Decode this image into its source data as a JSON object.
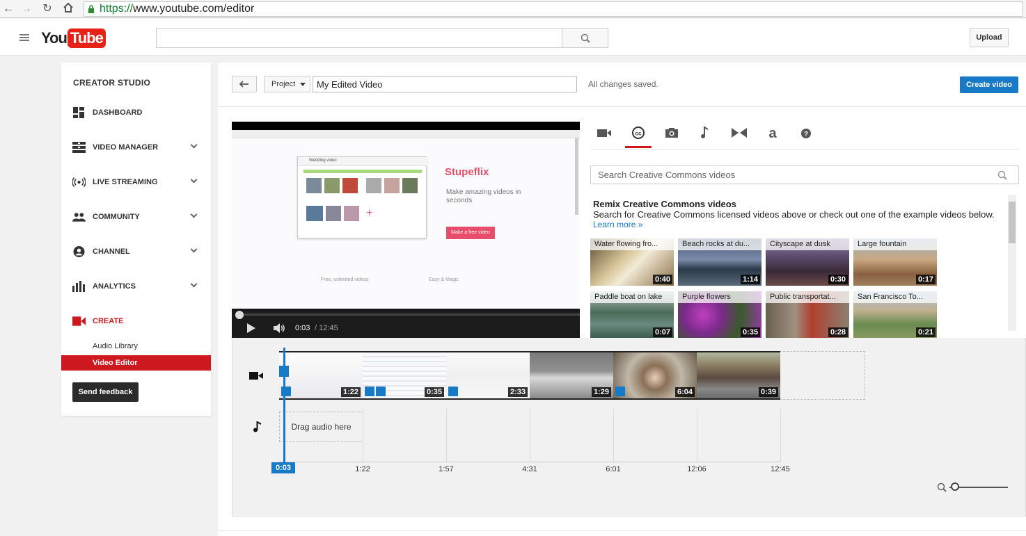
{
  "browser": {
    "url_scheme": "https://",
    "url_rest": "www.youtube.com/editor"
  },
  "masthead": {
    "logo_you": "You",
    "logo_tube": "Tube",
    "search_placeholder": "",
    "upload_label": "Upload"
  },
  "sidebar": {
    "title": "CREATOR STUDIO",
    "items": [
      {
        "label": "DASHBOARD",
        "icon": "dashboard-icon",
        "expandable": false
      },
      {
        "label": "VIDEO MANAGER",
        "icon": "video-manager-icon",
        "expandable": true
      },
      {
        "label": "LIVE STREAMING",
        "icon": "live-streaming-icon",
        "expandable": true
      },
      {
        "label": "COMMUNITY",
        "icon": "community-icon",
        "expandable": true
      },
      {
        "label": "CHANNEL",
        "icon": "channel-icon",
        "expandable": true
      },
      {
        "label": "ANALYTICS",
        "icon": "analytics-icon",
        "expandable": true
      },
      {
        "label": "CREATE",
        "icon": "create-icon",
        "expandable": false,
        "active": true
      }
    ],
    "subitems": [
      {
        "label": "Audio Library",
        "active": false
      },
      {
        "label": "Video Editor",
        "active": true
      }
    ],
    "feedback_label": "Send feedback"
  },
  "editor": {
    "project_label": "Project",
    "title_value": "My Edited Video",
    "status": "All changes saved.",
    "create_label": "Create video"
  },
  "player": {
    "current_time": "0:03",
    "total_time": " / 12:45",
    "preview_texts": {
      "brand": "Stupeflix",
      "tagline": "Make amazing videos in seconds",
      "cta": "Make a free video",
      "wedding": "Wedding video",
      "feature1": "Free, unlimited videos",
      "feature2": "Easy & Magic"
    }
  },
  "panel": {
    "tabs": [
      "video-camera-icon",
      "creative-commons-icon",
      "photo-camera-icon",
      "music-note-icon",
      "transitions-icon",
      "text-icon",
      "help-icon"
    ],
    "active_tab": 1,
    "search_placeholder": "Search Creative Commons videos",
    "heading": "Remix Creative Commons videos",
    "description": "Search for Creative Commons licensed videos above or check out one of the example videos below.",
    "learn_more": "Learn more »",
    "videos": [
      {
        "title": "Water flowing fro...",
        "duration": "0:40"
      },
      {
        "title": "Beach rocks at du...",
        "duration": "1:14"
      },
      {
        "title": "Cityscape at dusk",
        "duration": "0:30"
      },
      {
        "title": "Large fountain",
        "duration": "0:17"
      },
      {
        "title": "Paddle boat on lake",
        "duration": "0:07"
      },
      {
        "title": "Purple flowers",
        "duration": "0:35"
      },
      {
        "title": "Public transportat...",
        "duration": "0:28"
      },
      {
        "title": "San Francisco To...",
        "duration": "0:21"
      }
    ]
  },
  "timeline": {
    "clips": [
      {
        "duration": "1:22"
      },
      {
        "duration": "0:35"
      },
      {
        "duration": "2:33"
      },
      {
        "duration": "1:29"
      },
      {
        "duration": "6:04"
      },
      {
        "duration": "0:39"
      }
    ],
    "drag_audio": "Drag audio here",
    "playhead_label": "0:03",
    "ticks": [
      "1:22",
      "1:57",
      "4:31",
      "6:01",
      "12:06",
      "12:45"
    ]
  },
  "colors": {
    "accent_red": "#cc181e",
    "accent_blue": "#167ac6"
  }
}
